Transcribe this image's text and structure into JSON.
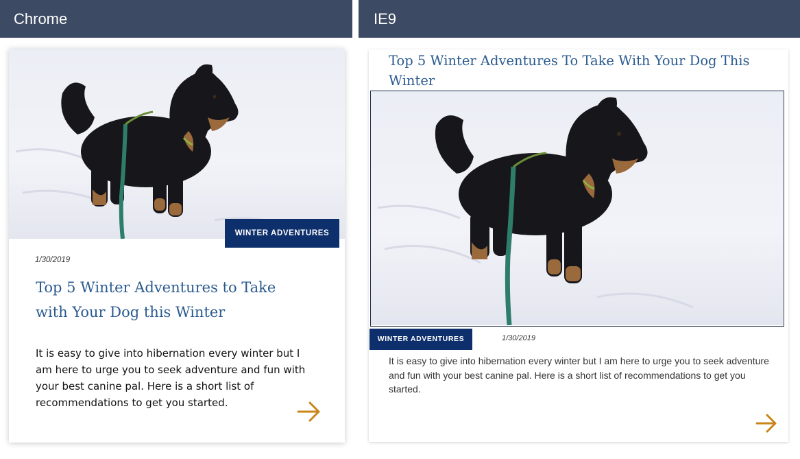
{
  "panels": {
    "chrome": {
      "label": "Chrome",
      "card": {
        "category_tag": "WINTER ADVENTURES",
        "date": "1/30/2019",
        "title": "Top 5 Winter Adventures to Take with Your Dog this Winter",
        "excerpt": "It is easy to give into hibernation every winter but I am here to urge you to seek adventure and fun with your best canine pal. Here is a short list of recommendations to get you started.",
        "arrow_icon": "arrow-right-icon"
      }
    },
    "ie9": {
      "label": "IE9",
      "card": {
        "title": "Top 5 Winter Adventures To Take With Your Dog This Winter",
        "category_tag": "WINTER ADVENTURES",
        "date": "1/30/2019",
        "excerpt": "It is easy to give into hibernation every winter but I am here to urge you to seek adventure and fun with your best canine pal. Here is a short list of recommendations to get you started.",
        "arrow_icon": "arrow-right-icon"
      }
    }
  },
  "colors": {
    "header_bg": "#3d4a63",
    "tag_bg": "#0d2f6b",
    "title_blue": "#2a5a8f",
    "arrow_gold": "#c8861a"
  }
}
